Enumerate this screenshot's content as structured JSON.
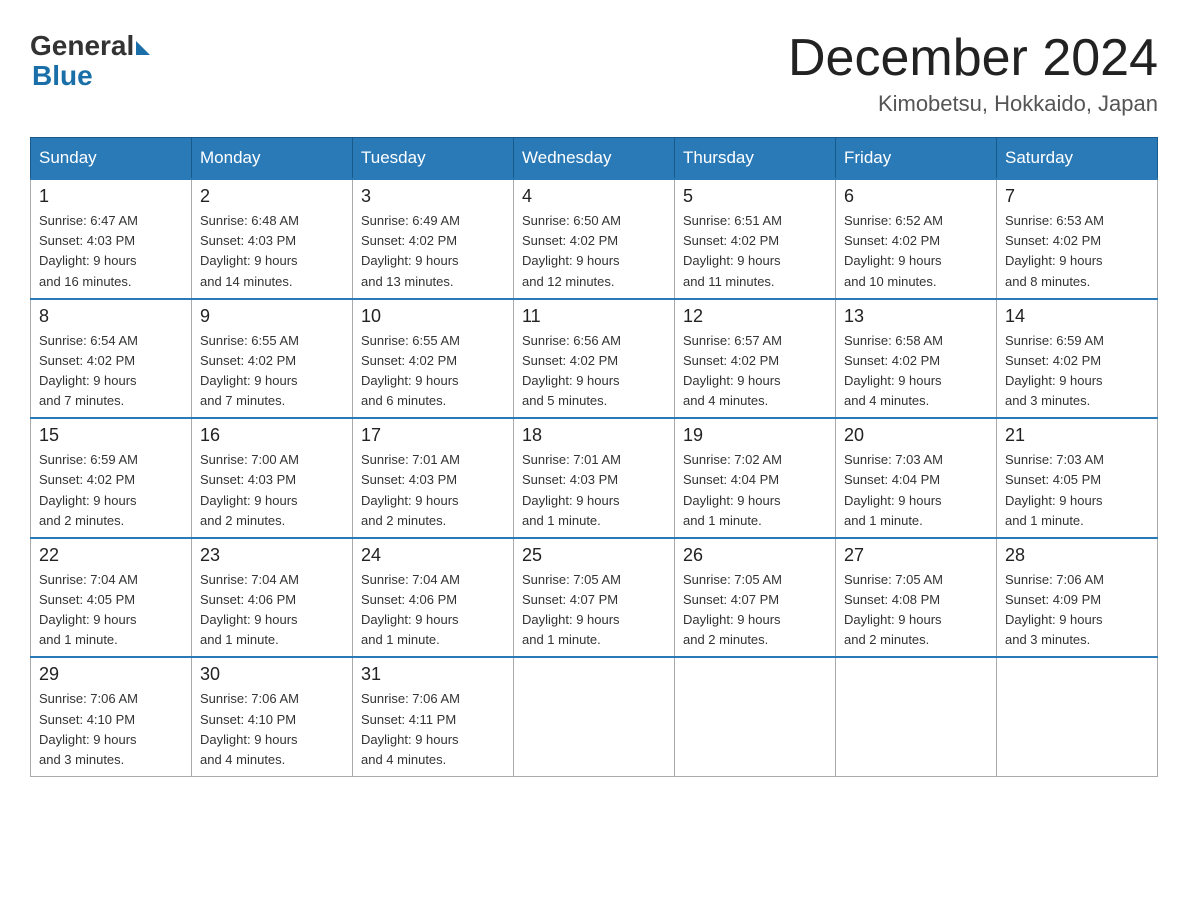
{
  "header": {
    "logo_general": "General",
    "logo_blue": "Blue",
    "month_title": "December 2024",
    "location": "Kimobetsu, Hokkaido, Japan"
  },
  "days_of_week": [
    "Sunday",
    "Monday",
    "Tuesday",
    "Wednesday",
    "Thursday",
    "Friday",
    "Saturday"
  ],
  "weeks": [
    [
      {
        "day": "1",
        "info": "Sunrise: 6:47 AM\nSunset: 4:03 PM\nDaylight: 9 hours\nand 16 minutes."
      },
      {
        "day": "2",
        "info": "Sunrise: 6:48 AM\nSunset: 4:03 PM\nDaylight: 9 hours\nand 14 minutes."
      },
      {
        "day": "3",
        "info": "Sunrise: 6:49 AM\nSunset: 4:02 PM\nDaylight: 9 hours\nand 13 minutes."
      },
      {
        "day": "4",
        "info": "Sunrise: 6:50 AM\nSunset: 4:02 PM\nDaylight: 9 hours\nand 12 minutes."
      },
      {
        "day": "5",
        "info": "Sunrise: 6:51 AM\nSunset: 4:02 PM\nDaylight: 9 hours\nand 11 minutes."
      },
      {
        "day": "6",
        "info": "Sunrise: 6:52 AM\nSunset: 4:02 PM\nDaylight: 9 hours\nand 10 minutes."
      },
      {
        "day": "7",
        "info": "Sunrise: 6:53 AM\nSunset: 4:02 PM\nDaylight: 9 hours\nand 8 minutes."
      }
    ],
    [
      {
        "day": "8",
        "info": "Sunrise: 6:54 AM\nSunset: 4:02 PM\nDaylight: 9 hours\nand 7 minutes."
      },
      {
        "day": "9",
        "info": "Sunrise: 6:55 AM\nSunset: 4:02 PM\nDaylight: 9 hours\nand 7 minutes."
      },
      {
        "day": "10",
        "info": "Sunrise: 6:55 AM\nSunset: 4:02 PM\nDaylight: 9 hours\nand 6 minutes."
      },
      {
        "day": "11",
        "info": "Sunrise: 6:56 AM\nSunset: 4:02 PM\nDaylight: 9 hours\nand 5 minutes."
      },
      {
        "day": "12",
        "info": "Sunrise: 6:57 AM\nSunset: 4:02 PM\nDaylight: 9 hours\nand 4 minutes."
      },
      {
        "day": "13",
        "info": "Sunrise: 6:58 AM\nSunset: 4:02 PM\nDaylight: 9 hours\nand 4 minutes."
      },
      {
        "day": "14",
        "info": "Sunrise: 6:59 AM\nSunset: 4:02 PM\nDaylight: 9 hours\nand 3 minutes."
      }
    ],
    [
      {
        "day": "15",
        "info": "Sunrise: 6:59 AM\nSunset: 4:02 PM\nDaylight: 9 hours\nand 2 minutes."
      },
      {
        "day": "16",
        "info": "Sunrise: 7:00 AM\nSunset: 4:03 PM\nDaylight: 9 hours\nand 2 minutes."
      },
      {
        "day": "17",
        "info": "Sunrise: 7:01 AM\nSunset: 4:03 PM\nDaylight: 9 hours\nand 2 minutes."
      },
      {
        "day": "18",
        "info": "Sunrise: 7:01 AM\nSunset: 4:03 PM\nDaylight: 9 hours\nand 1 minute."
      },
      {
        "day": "19",
        "info": "Sunrise: 7:02 AM\nSunset: 4:04 PM\nDaylight: 9 hours\nand 1 minute."
      },
      {
        "day": "20",
        "info": "Sunrise: 7:03 AM\nSunset: 4:04 PM\nDaylight: 9 hours\nand 1 minute."
      },
      {
        "day": "21",
        "info": "Sunrise: 7:03 AM\nSunset: 4:05 PM\nDaylight: 9 hours\nand 1 minute."
      }
    ],
    [
      {
        "day": "22",
        "info": "Sunrise: 7:04 AM\nSunset: 4:05 PM\nDaylight: 9 hours\nand 1 minute."
      },
      {
        "day": "23",
        "info": "Sunrise: 7:04 AM\nSunset: 4:06 PM\nDaylight: 9 hours\nand 1 minute."
      },
      {
        "day": "24",
        "info": "Sunrise: 7:04 AM\nSunset: 4:06 PM\nDaylight: 9 hours\nand 1 minute."
      },
      {
        "day": "25",
        "info": "Sunrise: 7:05 AM\nSunset: 4:07 PM\nDaylight: 9 hours\nand 1 minute."
      },
      {
        "day": "26",
        "info": "Sunrise: 7:05 AM\nSunset: 4:07 PM\nDaylight: 9 hours\nand 2 minutes."
      },
      {
        "day": "27",
        "info": "Sunrise: 7:05 AM\nSunset: 4:08 PM\nDaylight: 9 hours\nand 2 minutes."
      },
      {
        "day": "28",
        "info": "Sunrise: 7:06 AM\nSunset: 4:09 PM\nDaylight: 9 hours\nand 3 minutes."
      }
    ],
    [
      {
        "day": "29",
        "info": "Sunrise: 7:06 AM\nSunset: 4:10 PM\nDaylight: 9 hours\nand 3 minutes."
      },
      {
        "day": "30",
        "info": "Sunrise: 7:06 AM\nSunset: 4:10 PM\nDaylight: 9 hours\nand 4 minutes."
      },
      {
        "day": "31",
        "info": "Sunrise: 7:06 AM\nSunset: 4:11 PM\nDaylight: 9 hours\nand 4 minutes."
      },
      {
        "day": "",
        "info": ""
      },
      {
        "day": "",
        "info": ""
      },
      {
        "day": "",
        "info": ""
      },
      {
        "day": "",
        "info": ""
      }
    ]
  ]
}
